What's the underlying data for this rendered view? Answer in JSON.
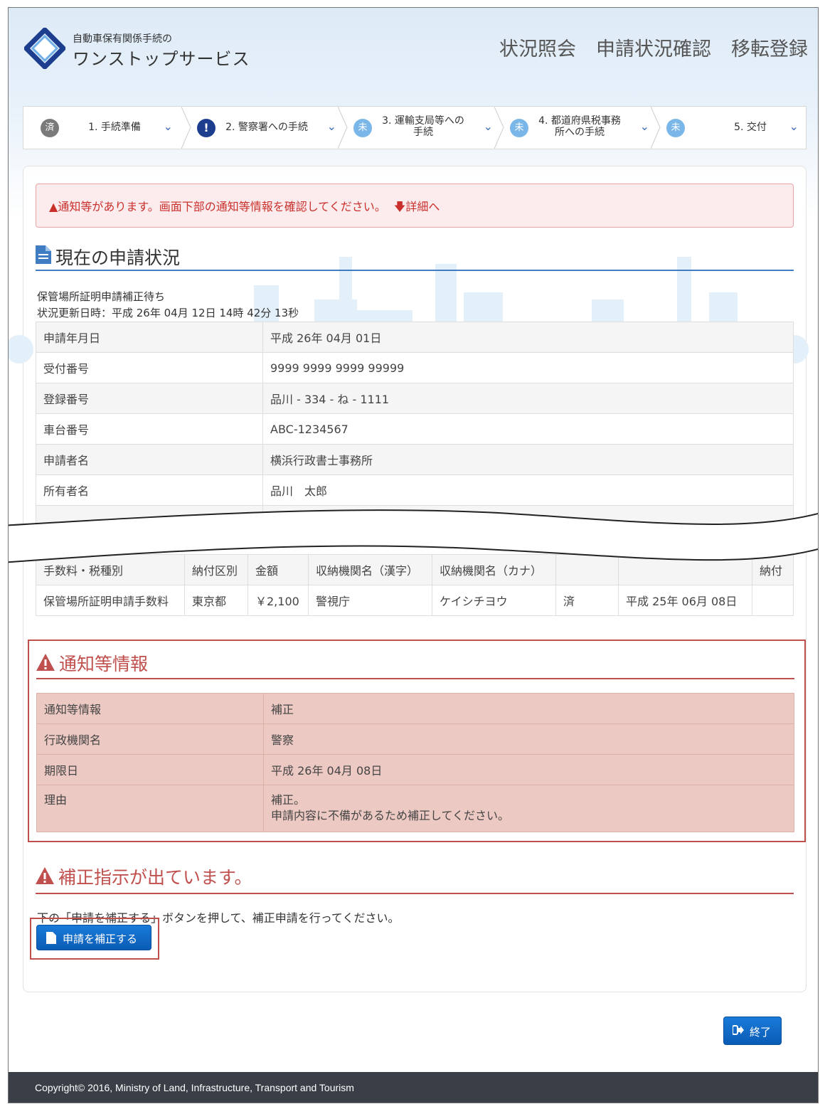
{
  "header": {
    "logo_small": "自動車保有関係手続の",
    "logo_big": "ワンストップサービス",
    "nav": [
      "状況照会",
      "申請状況確認",
      "移転登録"
    ]
  },
  "steps": [
    {
      "badge": "済",
      "label": "1. 手続準備",
      "color": "#7a7a7a"
    },
    {
      "badge": "!",
      "label": "2. 警察署への手続",
      "color": "#1d3d8f"
    },
    {
      "badge": "未",
      "label": "3. 運輸支局等への手続",
      "label_line1": "3. 運輸支局等への",
      "label_line2": "手続",
      "color": "#7ab6e8"
    },
    {
      "badge": "未",
      "label": "4. 都道府県税事務所への手続",
      "label_line1": "4. 都道府県税事務",
      "label_line2": "所への手続",
      "color": "#7ab6e8"
    },
    {
      "badge": "未",
      "label": "5. 交付",
      "color": "#7ab6e8"
    }
  ],
  "alert": {
    "text": "通知等があります。画面下部の通知等情報を確認してください。",
    "link": "詳細へ"
  },
  "status_section": {
    "title": "現在の申請状況",
    "status": "保管場所証明申請補正待ち",
    "updated": "状況更新日時：平成 26年 04月 12日 14時 42分 13秒"
  },
  "info_rows": [
    {
      "k": "申請年月日",
      "v": "平成 26年 04月 01日"
    },
    {
      "k": "受付番号",
      "v": "9999 9999 9999 99999"
    },
    {
      "k": "登録番号",
      "v": "品川 - 334 - ね - 1111"
    },
    {
      "k": "車台番号",
      "v": "ABC-1234567"
    },
    {
      "k": "申請者名",
      "v": "横浜行政書士事務所"
    },
    {
      "k": "所有者名",
      "v": "品川　太郎"
    }
  ],
  "fee_table": {
    "headers": [
      "手数料・税種別",
      "納付区別",
      "金額",
      "収納機関名（漢字）",
      "収納機関名（カナ）",
      "",
      "",
      "納付"
    ],
    "row": [
      "保管場所証明申請手数料",
      "東京都",
      "￥2,100",
      "警視庁",
      "ケイシチヨウ",
      "済",
      "平成 25年 06月 08日",
      ""
    ]
  },
  "notice": {
    "title": "通知等情報",
    "rows": [
      {
        "k": "通知等情報",
        "v": "補正"
      },
      {
        "k": "行政機関名",
        "v": "警察"
      },
      {
        "k": "期限日",
        "v": "平成 26年 04月 08日"
      }
    ],
    "reason_label": "理由",
    "reason_line1": "補正。",
    "reason_line2": "申請内容に不備があるため補正してください。"
  },
  "correction": {
    "title": "補正指示が出ています。",
    "text": "下の「申請を補正する」ボタンを押して、補正申請を行ってください。",
    "button": "申請を補正する"
  },
  "end_button": "終了",
  "footer": "Copyright© 2016, Ministry of Land, Infrastructure, Transport and Tourism",
  "colors": {
    "accent": "#3f7cc1",
    "warning": "#c0504d",
    "button": "#0a5cb5"
  }
}
